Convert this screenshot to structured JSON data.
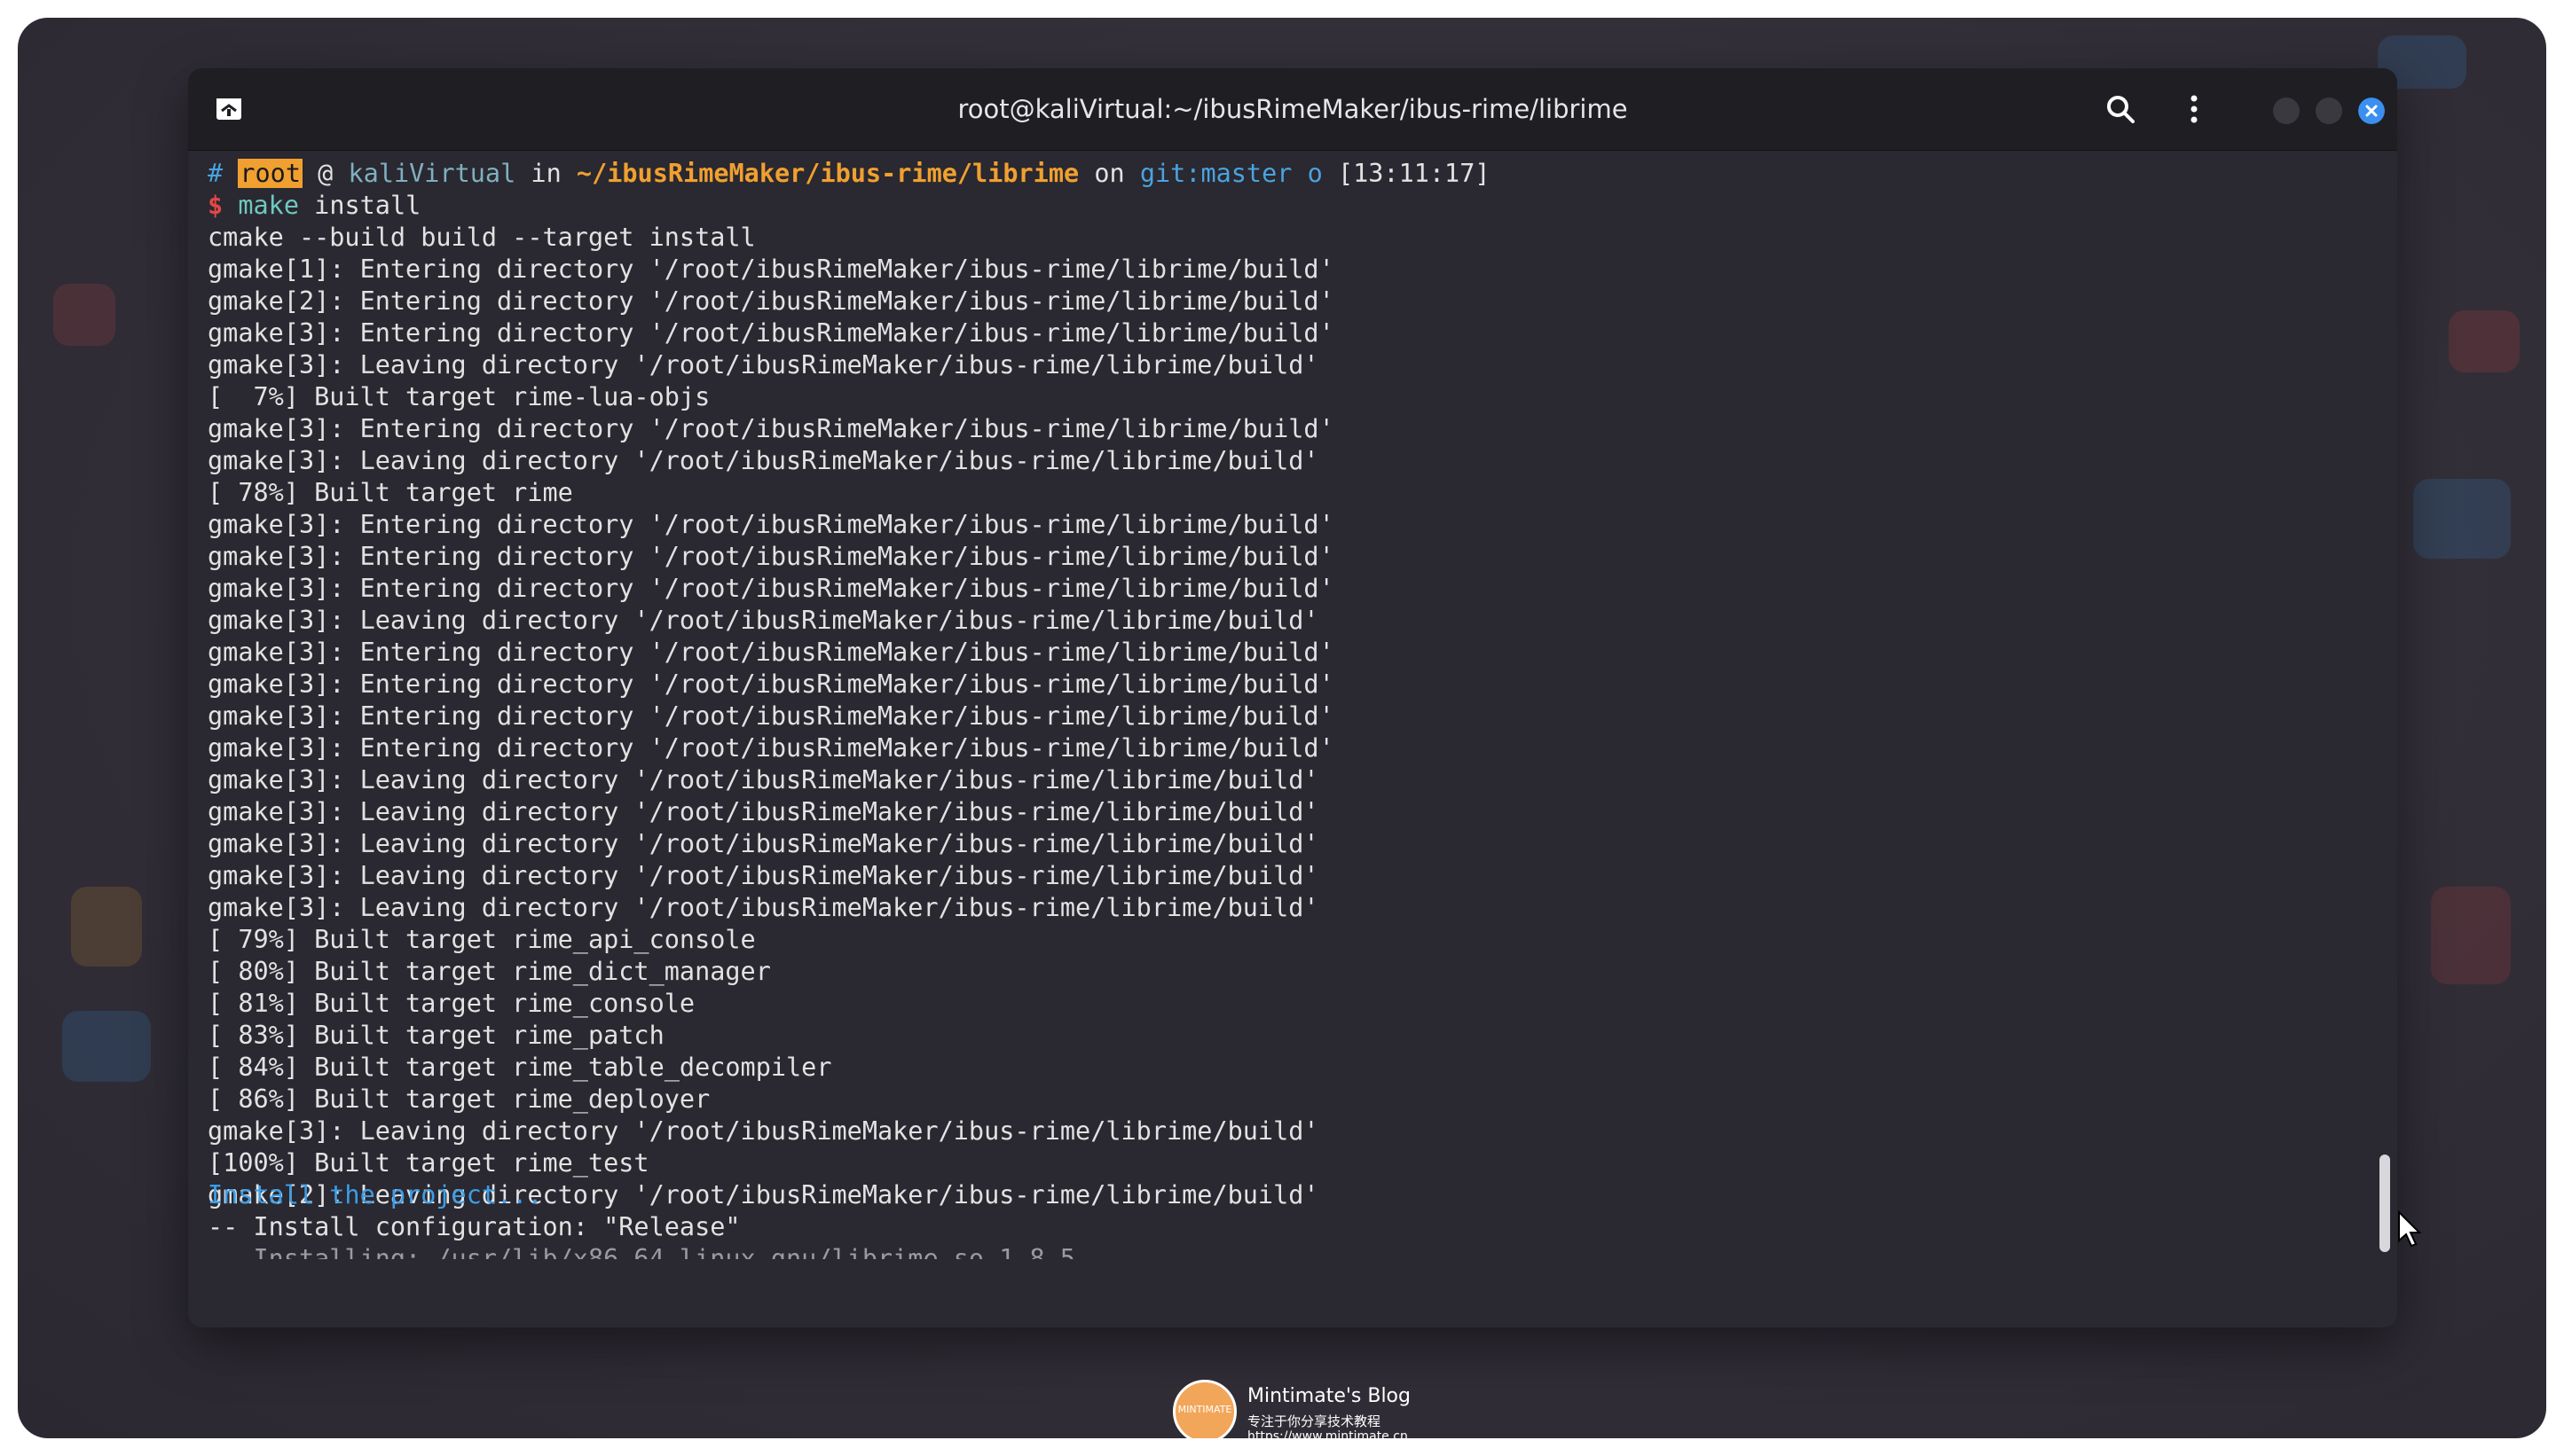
{
  "window": {
    "title": "root@kaliVirtual:~/ibusRimeMaker/ibus-rime/librime"
  },
  "prompt": {
    "hash": "#",
    "user": "root",
    "at": "@",
    "host": "kaliVirtual",
    "in": "in",
    "path": "~/ibusRimeMaker/ibus-rime/librime",
    "on": "on",
    "git": "git:master",
    "git_status": "o",
    "time": "[13:11:17]",
    "dollar": "$",
    "cmd": "make",
    "args": "install"
  },
  "output": [
    "cmake --build build --target install",
    "gmake[1]: Entering directory '/root/ibusRimeMaker/ibus-rime/librime/build'",
    "gmake[2]: Entering directory '/root/ibusRimeMaker/ibus-rime/librime/build'",
    "gmake[3]: Entering directory '/root/ibusRimeMaker/ibus-rime/librime/build'",
    "gmake[3]: Leaving directory '/root/ibusRimeMaker/ibus-rime/librime/build'",
    "[  7%] Built target rime-lua-objs",
    "gmake[3]: Entering directory '/root/ibusRimeMaker/ibus-rime/librime/build'",
    "gmake[3]: Leaving directory '/root/ibusRimeMaker/ibus-rime/librime/build'",
    "[ 78%] Built target rime",
    "gmake[3]: Entering directory '/root/ibusRimeMaker/ibus-rime/librime/build'",
    "gmake[3]: Entering directory '/root/ibusRimeMaker/ibus-rime/librime/build'",
    "gmake[3]: Entering directory '/root/ibusRimeMaker/ibus-rime/librime/build'",
    "gmake[3]: Leaving directory '/root/ibusRimeMaker/ibus-rime/librime/build'",
    "gmake[3]: Entering directory '/root/ibusRimeMaker/ibus-rime/librime/build'",
    "gmake[3]: Entering directory '/root/ibusRimeMaker/ibus-rime/librime/build'",
    "gmake[3]: Entering directory '/root/ibusRimeMaker/ibus-rime/librime/build'",
    "gmake[3]: Entering directory '/root/ibusRimeMaker/ibus-rime/librime/build'",
    "gmake[3]: Leaving directory '/root/ibusRimeMaker/ibus-rime/librime/build'",
    "gmake[3]: Leaving directory '/root/ibusRimeMaker/ibus-rime/librime/build'",
    "gmake[3]: Leaving directory '/root/ibusRimeMaker/ibus-rime/librime/build'",
    "gmake[3]: Leaving directory '/root/ibusRimeMaker/ibus-rime/librime/build'",
    "gmake[3]: Leaving directory '/root/ibusRimeMaker/ibus-rime/librime/build'",
    "[ 79%] Built target rime_api_console",
    "[ 80%] Built target rime_dict_manager",
    "[ 81%] Built target rime_console",
    "[ 83%] Built target rime_patch",
    "[ 84%] Built target rime_table_decompiler",
    "[ 86%] Built target rime_deployer",
    "gmake[3]: Leaving directory '/root/ibusRimeMaker/ibus-rime/librime/build'",
    "[100%] Built target rime_test",
    "gmake[2]: Leaving directory '/root/ibusRimeMaker/ibus-rime/librime/build'"
  ],
  "install_line": "Install the project...",
  "config_line": "-- Install configuration: \"Release\"",
  "scroll": {
    "position_fraction": 0.93
  },
  "watermark": {
    "logo_text": "MINTIMATE",
    "name": "Mintimate's Blog",
    "subtitle": "专注于你分享技术教程",
    "url": "https://www.mintimate.cn"
  },
  "icons": {
    "new_tab": "terminal-tab-icon",
    "search": "search-icon",
    "menu": "kebab-menu-icon",
    "minimize": "minimize-button",
    "maximize": "maximize-button",
    "close": "close-icon"
  }
}
